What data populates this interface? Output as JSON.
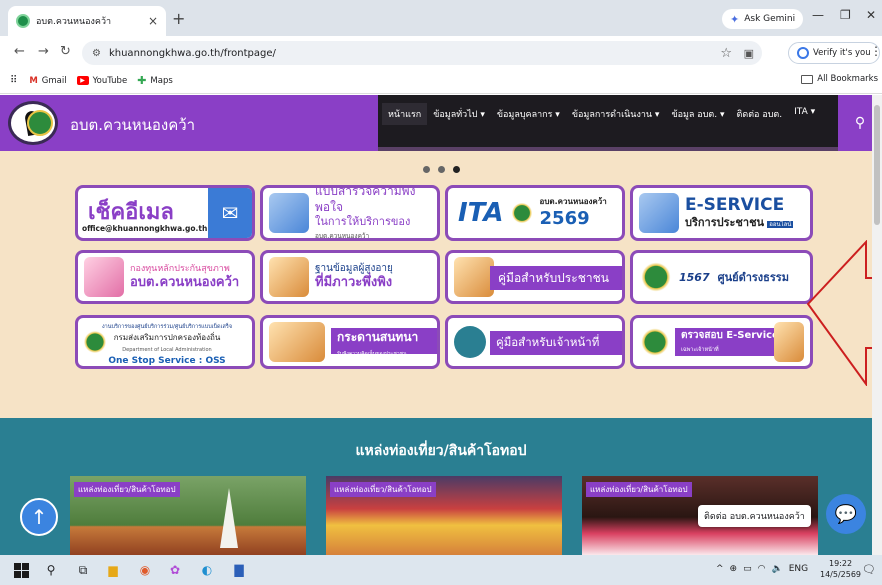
{
  "browser": {
    "tab_title": "อบต.ควนหนองคว้า",
    "tab_close": "×",
    "new_tab": "+",
    "gemini_label": "Ask Gemini",
    "url": "khuannongkhwa.go.th/frontpage/",
    "verify_label": "Verify it's you",
    "bookmarks": [
      {
        "label": "Gmail"
      },
      {
        "label": "YouTube"
      },
      {
        "label": "Maps"
      }
    ],
    "all_bookmarks": "All Bookmarks"
  },
  "site": {
    "name": "อบต.ควนหนองคว้า",
    "menu": [
      {
        "label": "หน้าแรก",
        "active": true
      },
      {
        "label": "ข้อมูลทั่วไป ▾"
      },
      {
        "label": "ข้อมูลบุคลากร ▾"
      },
      {
        "label": "ข้อมูลการดำเนินงาน ▾"
      },
      {
        "label": "ข้อมูล อบต. ▾"
      },
      {
        "label": "ติดต่อ อบต."
      },
      {
        "label": "ITA ▾"
      }
    ],
    "cards": {
      "email": {
        "title": "เช็คอีเมล",
        "address": "office@khuannongkhwa.go.th"
      },
      "survey": {
        "line1": "แบบสำรวจความพึงพอใจ",
        "line2": "ในการให้บริการของ",
        "line3": "อบต.ควนหนองคว้า"
      },
      "ita": {
        "logo": "ITA",
        "org": "อบต.ควนหนองคว้า",
        "year": "2569"
      },
      "eservice": {
        "title": "E-SERVICE",
        "subtitle": "บริการประชาชน",
        "badge": "ออนไลน์"
      },
      "health": {
        "line1": "กองทุนหลักประกันสุขภาพ",
        "line2": "อบต.ควนหนองคว้า"
      },
      "elderly": {
        "line1": "ฐานข้อมูลผู้สูงอายุ",
        "line2": "ที่มีภาวะพึ่งพิง"
      },
      "citizen_manual": {
        "label": "คู่มือสำหรับประชาชน"
      },
      "justice": {
        "number": "1567",
        "label": "ศูนย์ดำรงธรรม"
      },
      "oss": {
        "line1": "งานบริการของศูนย์บริการร่วม/ศูนย์บริการแบบเบ็ดเสร็จ",
        "line2": "กรมส่งเสริมการปกครองท้องถิ่น",
        "line3": "Department of Local Administration",
        "line4": "One Stop Service : OSS"
      },
      "board": {
        "title": "กระดานสนทนา",
        "subtitle": "รับฟังความคิดเห็นของประชาชน"
      },
      "staff_manual": {
        "label": "คู่มือสำหรับเจ้าหน้าที่"
      },
      "check_eservice": {
        "title": "ตรวจสอบ E-Service",
        "subtitle": "เฉพาะเจ้าหน้าที่"
      }
    },
    "tourism": {
      "heading": "แหล่งท่องเที่ยว/สินค้าโอทอป",
      "tag": "แหล่งท่องเที่ยว/สินค้าโอทอป"
    },
    "chat_tooltip": "ติดต่อ อบต.ควนหนองคว้า"
  },
  "taskbar": {
    "lang": "ENG",
    "time": "19:22",
    "date": "14/5/2569"
  },
  "colors": {
    "brand_purple": "#8a3fc6",
    "teal": "#2a7f92",
    "annotation_red": "#cc1f1f"
  }
}
